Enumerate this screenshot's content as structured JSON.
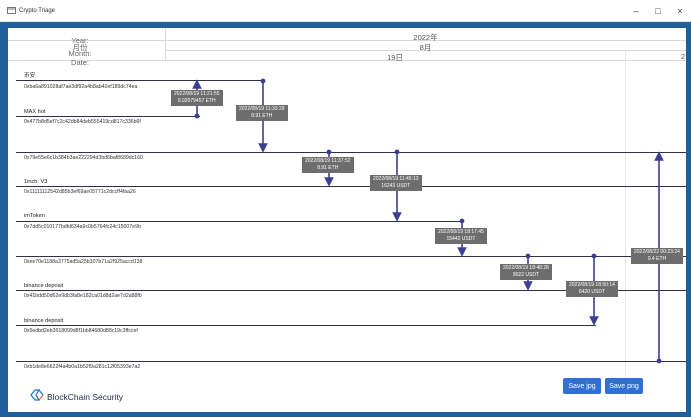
{
  "window": {
    "title": "Crypto Triage",
    "controls": [
      "–",
      "□",
      "×"
    ]
  },
  "header": {
    "year_label": "Year:",
    "month_label": "Month:",
    "date_label": "Date:",
    "month_label_cn": "月份",
    "year_value": "2022年",
    "month_value": "8月",
    "date_value": "19日",
    "date_value_next": "2"
  },
  "accounts": [
    {
      "name": "币安",
      "address": "0xba6a891028af7ae3df92a4b8ab42ef189dc74ea"
    },
    {
      "name": "MAX hot",
      "address": "0x477b8d5ef7c2c42db84deb555419cd817c336b6f"
    },
    {
      "name": "",
      "address": "0x79e55e6c1b384b3ae222294d3bd6baf8689dc160"
    },
    {
      "name": "1inch: V3",
      "address": "0x11111112542d85b3ef69ae05771c2dccff4faa26"
    },
    {
      "name": "imToken",
      "address": "0x7dd5c010177bdfd634a9c0b5764fc24c15007e9b"
    },
    {
      "name": "",
      "address": "0xee70e1188a3775ad5a25b307b71a2f925accd138"
    },
    {
      "name": "binance deposit",
      "address": "0x41bdd50d62e9db3fa8e182ca01d8d2ae7d2a88fb"
    },
    {
      "name": "binance deposit",
      "address": "0x5edbd2eb3618099d8f1bb84680d88c19c3ffccef"
    },
    {
      "name": "",
      "address": "0xb1de8e6622f4a4b0a1b52f9a281c12f05393e7a2"
    }
  ],
  "transactions": [
    {
      "time": "2022/08/19 11:21:55",
      "amount": "8.92079457 ETH"
    },
    {
      "time": "2022/08/19 11:33:29",
      "amount": "8.91 ETH"
    },
    {
      "time": "2022/08/19 11:37:52",
      "amount": "8.91 ETH"
    },
    {
      "time": "2022/08/19 11:45:13",
      "amount": "16243 USDT"
    },
    {
      "time": "2022/08/19 18:17:45",
      "amount": "15442 USDT"
    },
    {
      "time": "2022/08/19 18:48:28",
      "amount": "9022 USDT"
    },
    {
      "time": "2022/08/19 18:50:14",
      "amount": "6420 USDT"
    },
    {
      "time": "2022/08/22 00:23:24",
      "amount": "0.4 ETH"
    }
  ],
  "buttons": {
    "save_jpg": "Save jpg",
    "save_png": "Save png"
  },
  "logo": {
    "text": "BlockChain Security"
  },
  "colors": {
    "accent": "#2f6fd6",
    "arrow": "#3a3f8f",
    "frame": "#1f5f9c"
  }
}
